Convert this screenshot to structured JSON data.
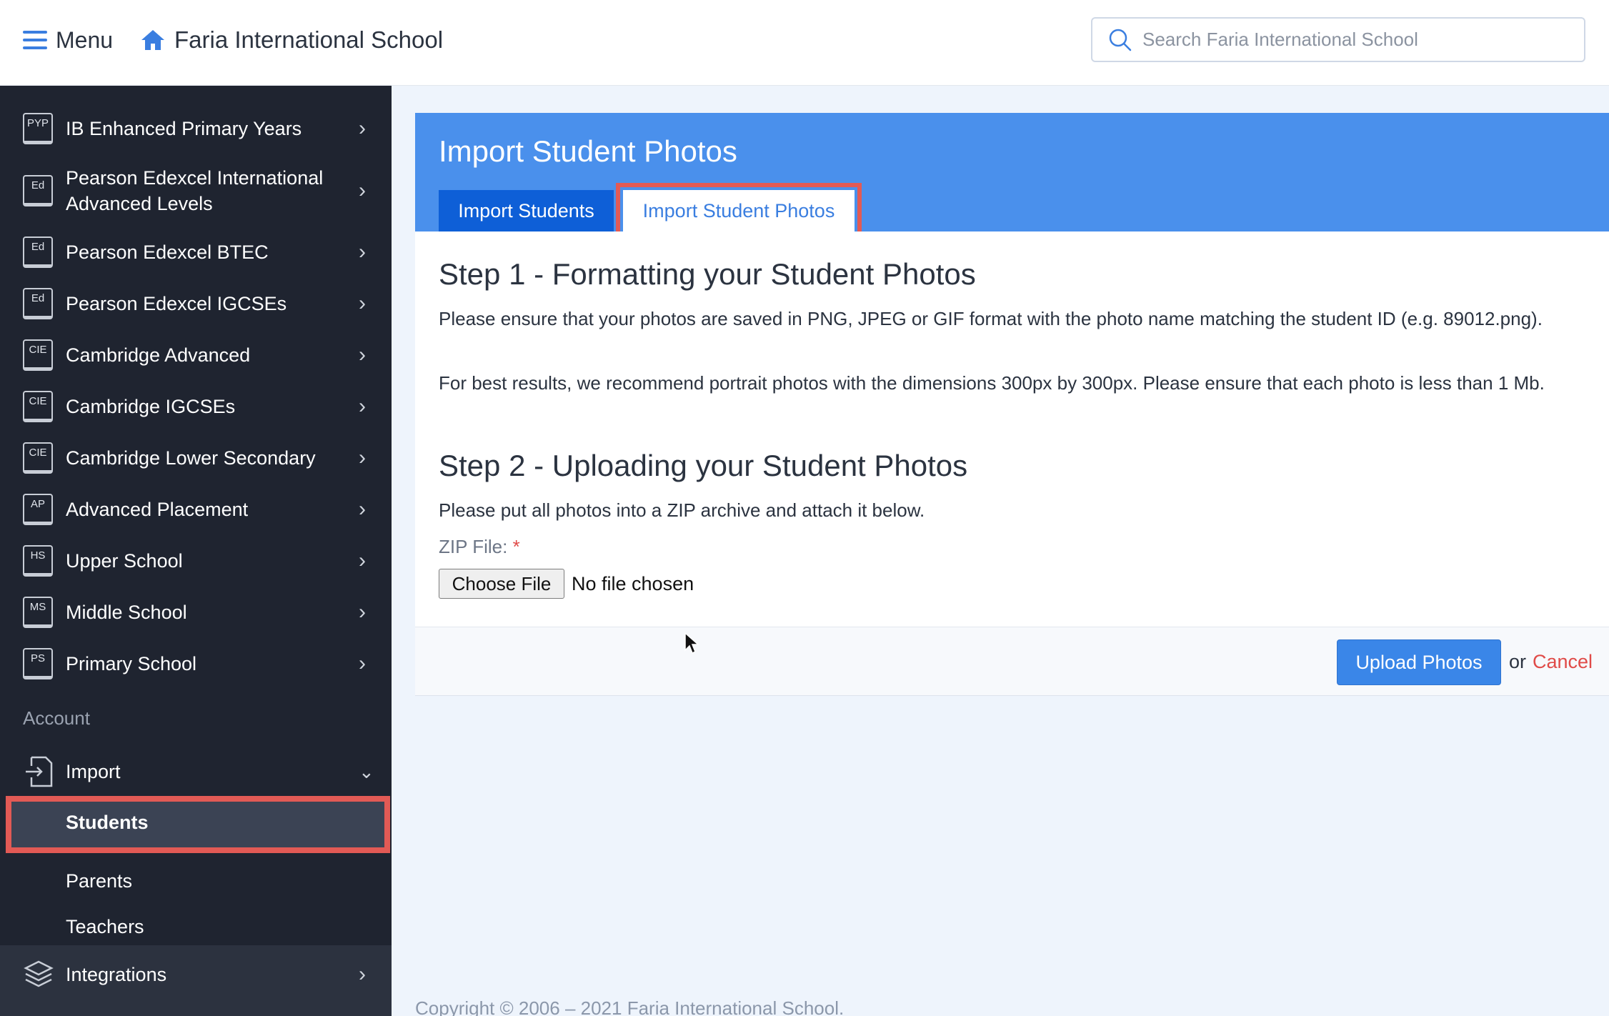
{
  "topbar": {
    "menu_label": "Menu",
    "school_name": "Faria International School",
    "search_placeholder": "Search Faria International School"
  },
  "sidebar": {
    "items": [
      {
        "badge": "PYP",
        "label": "IB Enhanced Primary Years"
      },
      {
        "badge": "Ed",
        "label": "Pearson Edexcel International Advanced Levels"
      },
      {
        "badge": "Ed",
        "label": "Pearson Edexcel BTEC"
      },
      {
        "badge": "Ed",
        "label": "Pearson Edexcel IGCSEs"
      },
      {
        "badge": "CIE",
        "label": "Cambridge Advanced"
      },
      {
        "badge": "CIE",
        "label": "Cambridge IGCSEs"
      },
      {
        "badge": "CIE",
        "label": "Cambridge Lower Secondary"
      },
      {
        "badge": "AP",
        "label": "Advanced Placement"
      },
      {
        "badge": "HS",
        "label": "Upper School"
      },
      {
        "badge": "MS",
        "label": "Middle School"
      },
      {
        "badge": "PS",
        "label": "Primary School"
      }
    ],
    "account_label": "Account",
    "import_label": "Import",
    "import_sub": [
      "Students",
      "Parents",
      "Teachers"
    ],
    "integrations_label": "Integrations"
  },
  "card": {
    "title": "Import Student Photos",
    "tabs": [
      "Import Students",
      "Import Student Photos"
    ],
    "step1_title": "Step 1 - Formatting your Student Photos",
    "step1_p1": "Please ensure that your photos are saved in PNG, JPEG or GIF format with the photo name matching the student ID (e.g. 89012.png).",
    "step1_p2": "For best results, we recommend portrait photos with the dimensions 300px by 300px. Please ensure that each photo is less than 1 Mb.",
    "step2_title": "Step 2 - Uploading your Student Photos",
    "step2_p1": "Please put all photos into a ZIP archive and attach it below.",
    "zip_label": "ZIP File:",
    "required_mark": "*",
    "choose_file": "Choose File",
    "file_status": "No file chosen",
    "upload_label": "Upload Photos",
    "or_text": "or",
    "cancel_label": "Cancel"
  },
  "footer": {
    "copyright": "Copyright © 2006 – 2021 Faria International School."
  },
  "colors": {
    "accent": "#4a90ec",
    "tab_active": "#0e5fd7",
    "highlight": "#e25a55",
    "sidebar_bg": "#1f2430",
    "cancel": "#e04b48"
  }
}
